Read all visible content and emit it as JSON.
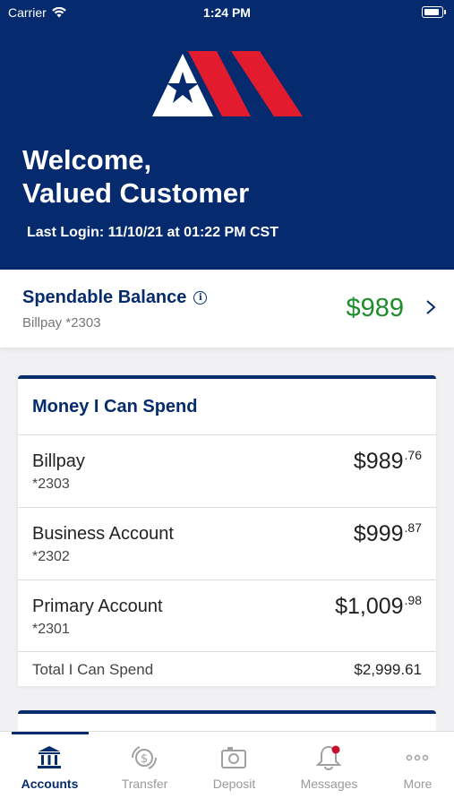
{
  "status_bar": {
    "carrier": "Carrier",
    "time": "1:24 PM"
  },
  "header": {
    "welcome_line1": "Welcome,",
    "welcome_line2": "Valued Customer",
    "last_login": "Last Login: 11/10/21 at 01:22 PM CST"
  },
  "spendable": {
    "title": "Spendable Balance",
    "account": "Billpay *2303",
    "amount": "$989"
  },
  "money_card": {
    "title": "Money I Can Spend",
    "accounts": [
      {
        "name": "Billpay",
        "number": "*2303",
        "balance_main": "$989",
        "balance_cents": ".76"
      },
      {
        "name": "Business Account",
        "number": "*2302",
        "balance_main": "$999",
        "balance_cents": ".87"
      },
      {
        "name": "Primary Account",
        "number": "*2301",
        "balance_main": "$1,009",
        "balance_cents": ".98"
      }
    ],
    "total_label": "Total I Can Spend",
    "total_value": "$2,999.61"
  },
  "tabs": [
    {
      "label": "Accounts",
      "icon": "bank-icon",
      "active": true
    },
    {
      "label": "Transfer",
      "icon": "transfer-icon",
      "active": false
    },
    {
      "label": "Deposit",
      "icon": "camera-icon",
      "active": false
    },
    {
      "label": "Messages",
      "icon": "bell-icon",
      "active": false
    },
    {
      "label": "More",
      "icon": "more-icon",
      "active": false
    }
  ],
  "colors": {
    "brand_navy": "#052a6e",
    "brand_red": "#e31b2f",
    "positive_green": "#1d8c2b",
    "notification_dot": "#c8102e"
  }
}
